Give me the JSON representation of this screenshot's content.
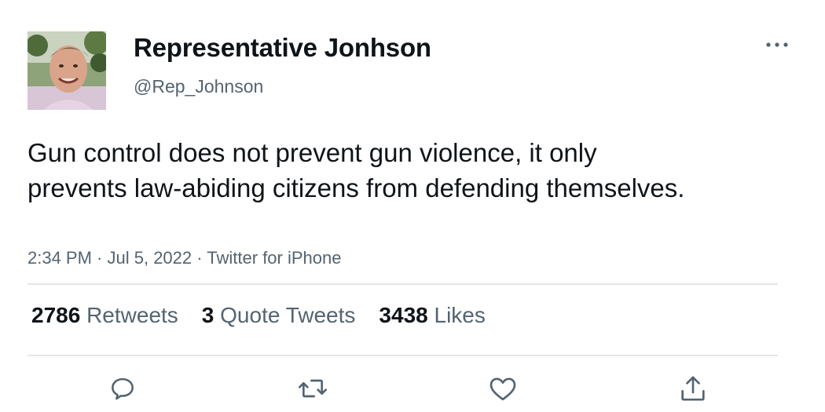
{
  "tweet": {
    "author": {
      "display_name": "Representative Jonhson",
      "handle": "@Rep_Johnson"
    },
    "text": "Gun control does not prevent gun violence, it only prevents law-abiding citizens from defending themselves.",
    "time": "2:34 PM",
    "separator": " · ",
    "date": "Jul 5, 2022",
    "source": "Twitter for iPhone",
    "stats": [
      {
        "count": "2786",
        "label": "Retweets"
      },
      {
        "count": "3",
        "label": "Quote Tweets"
      },
      {
        "count": "3438",
        "label": "Likes"
      }
    ]
  },
  "icons": {
    "more": "more-horizontal-icon",
    "reply": "reply-icon",
    "retweet": "retweet-icon",
    "like": "heart-icon",
    "share": "share-icon"
  },
  "colors": {
    "text_primary": "#0f1419",
    "text_secondary": "#536471",
    "divider": "#e4e7ea"
  }
}
